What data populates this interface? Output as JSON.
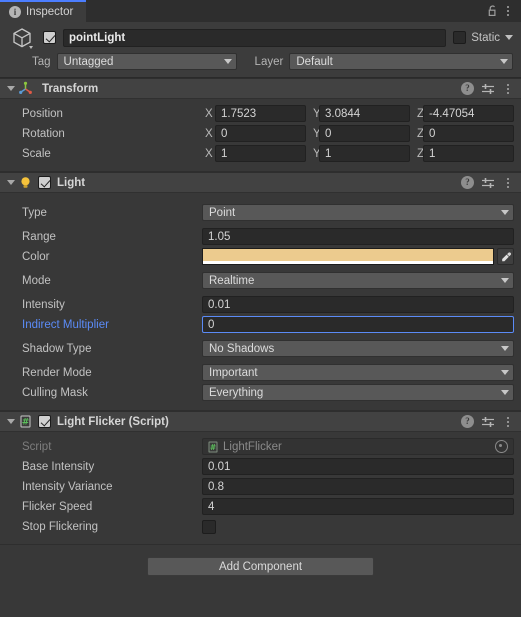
{
  "window": {
    "tab_label": "Inspector",
    "tab_icon": "info-icon",
    "lock_icon": "padlock-open-icon",
    "menu_icon": "kebab-menu-icon",
    "accent_color": "#4C7EFF"
  },
  "gameobject": {
    "icon": "cube-icon",
    "enabled": true,
    "name": "pointLight",
    "static_label": "Static",
    "static_checked": false,
    "tag_label": "Tag",
    "tag_value": "Untagged",
    "layer_label": "Layer",
    "layer_value": "Default"
  },
  "components": [
    {
      "id": "transform",
      "title": "Transform",
      "icon": "transform-gizmo-icon",
      "has_enable_toggle": false,
      "expanded": true,
      "rows": [
        {
          "label": "Position",
          "type": "vector3",
          "axes": [
            "X",
            "Y",
            "Z"
          ],
          "values": [
            "1.7523",
            "3.0844",
            "-4.47054"
          ]
        },
        {
          "label": "Rotation",
          "type": "vector3",
          "axes": [
            "X",
            "Y",
            "Z"
          ],
          "values": [
            "0",
            "0",
            "0"
          ]
        },
        {
          "label": "Scale",
          "type": "vector3",
          "axes": [
            "X",
            "Y",
            "Z"
          ],
          "values": [
            "1",
            "1",
            "1"
          ]
        }
      ]
    },
    {
      "id": "light",
      "title": "Light",
      "icon": "lightbulb-icon",
      "has_enable_toggle": true,
      "enabled": true,
      "expanded": true,
      "rows": [
        {
          "label": "Type",
          "type": "dropdown",
          "value": "Point"
        },
        {
          "label": "Range",
          "type": "text",
          "value": "1.05"
        },
        {
          "label": "Color",
          "type": "color",
          "value": "#ECCB8E",
          "alpha_color": "#FFFFFF"
        },
        {
          "label": "Mode",
          "type": "dropdown",
          "value": "Realtime"
        },
        {
          "label": "Intensity",
          "type": "text",
          "value": "0.01"
        },
        {
          "label": "Indirect Multiplier",
          "type": "text",
          "value": "0",
          "focused": true
        },
        {
          "label": "Shadow Type",
          "type": "dropdown",
          "value": "No Shadows"
        },
        {
          "label": "Render Mode",
          "type": "dropdown",
          "value": "Important"
        },
        {
          "label": "Culling Mask",
          "type": "dropdown",
          "value": "Everything"
        }
      ]
    },
    {
      "id": "light-flicker",
      "title": "Light Flicker (Script)",
      "icon": "csharp-script-icon",
      "has_enable_toggle": true,
      "enabled": true,
      "expanded": true,
      "rows": [
        {
          "label": "Script",
          "type": "object",
          "value": "LightFlicker",
          "readonly": true
        },
        {
          "label": "Base Intensity",
          "type": "text",
          "value": "0.01"
        },
        {
          "label": "Intensity Variance",
          "type": "text",
          "value": "0.8"
        },
        {
          "label": "Flicker Speed",
          "type": "text",
          "value": "4"
        },
        {
          "label": "Stop Flickering",
          "type": "checkbox",
          "checked": false
        }
      ]
    }
  ],
  "footer": {
    "add_component_label": "Add Component"
  },
  "header_icons": {
    "help": "?",
    "preset": "preset-sliders-icon",
    "menu": "kebab-menu-icon"
  }
}
